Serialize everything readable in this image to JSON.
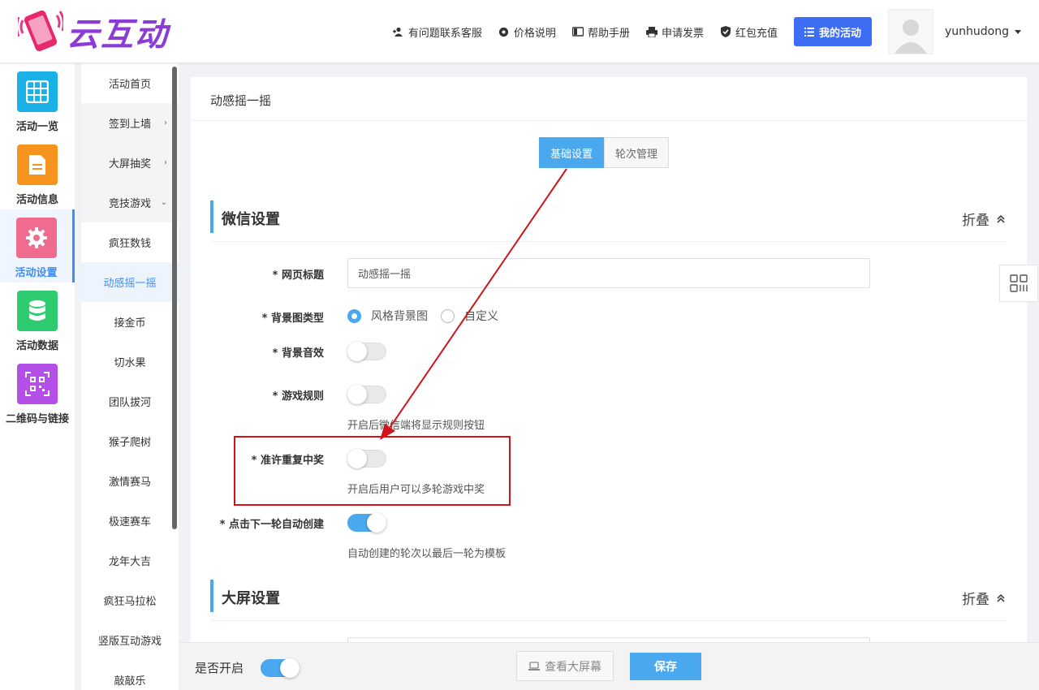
{
  "header": {
    "logo_text": "云互动",
    "nav": [
      {
        "label": "有问题联系客服",
        "icon": "user-add-icon"
      },
      {
        "label": "价格说明",
        "icon": "gear-icon"
      },
      {
        "label": "帮助手册",
        "icon": "book-icon"
      },
      {
        "label": "申请发票",
        "icon": "printer-icon"
      },
      {
        "label": "红包充值",
        "icon": "shield-check-icon"
      }
    ],
    "my_activity_label": "我的活动",
    "username": "yunhudong"
  },
  "sidebar": {
    "items": [
      {
        "label": "活动一览",
        "icon": "grid-icon",
        "color": "#1ab0e8"
      },
      {
        "label": "活动信息",
        "icon": "document-icon",
        "color": "#f7941d"
      },
      {
        "label": "活动设置",
        "icon": "gear-icon",
        "color": "#f06c8f"
      },
      {
        "label": "活动数据",
        "icon": "database-icon",
        "color": "#2ecc71"
      },
      {
        "label": "二维码与链接",
        "icon": "qrcode-icon",
        "color": "#b44fe8"
      }
    ]
  },
  "submenu": {
    "items": [
      {
        "label": "活动首页",
        "arrow": ""
      },
      {
        "label": "签到上墙",
        "arrow": "›"
      },
      {
        "label": "大屏抽奖",
        "arrow": "›"
      },
      {
        "label": "竞技游戏",
        "arrow": "⌄"
      },
      {
        "label": "疯狂数钱",
        "arrow": ""
      },
      {
        "label": "动感摇一摇",
        "arrow": ""
      },
      {
        "label": "接金币",
        "arrow": ""
      },
      {
        "label": "切水果",
        "arrow": ""
      },
      {
        "label": "团队拔河",
        "arrow": ""
      },
      {
        "label": "猴子爬树",
        "arrow": ""
      },
      {
        "label": "激情赛马",
        "arrow": ""
      },
      {
        "label": "极速赛车",
        "arrow": ""
      },
      {
        "label": "龙年大吉",
        "arrow": ""
      },
      {
        "label": "疯狂马拉松",
        "arrow": ""
      },
      {
        "label": "竖版互动游戏",
        "arrow": ""
      },
      {
        "label": "敲敲乐",
        "arrow": ""
      }
    ]
  },
  "main": {
    "title": "动感摇一摇",
    "tabs": [
      {
        "label": "基础设置"
      },
      {
        "label": "轮次管理"
      }
    ],
    "wechat_section": {
      "title": "微信设置",
      "fold_label": "折叠",
      "page_title_label": "* 网页标题",
      "page_title_value": "动感摇一摇",
      "bg_type_label": "* 背景图类型",
      "bg_type_options": [
        "风格背景图",
        "自定义"
      ],
      "bg_type_selected": "风格背景图",
      "bg_sound_label": "* 背景音效",
      "bg_sound_on": false,
      "rules_label": "* 游戏规则",
      "rules_on": false,
      "rules_hint": "开启后微信端将显示规则按钮",
      "repeat_win_label": "* 准许重复中奖",
      "repeat_win_on": false,
      "repeat_win_hint": "开启后用户可以多轮游戏中奖",
      "auto_next_label": "* 点击下一轮自动创建",
      "auto_next_on": true,
      "auto_next_hint": "自动创建的轮次以最后一轮为模板"
    },
    "screen_section": {
      "title": "大屏设置",
      "fold_label": "折叠"
    }
  },
  "bottom_bar": {
    "enable_label": "是否开启",
    "enable_on": true,
    "preview_label": "查看大屏幕",
    "save_label": "保存"
  },
  "colors": {
    "accent": "#4aa8ee",
    "primary_button": "#3d6cf5",
    "annotation_red": "#d0141c"
  }
}
